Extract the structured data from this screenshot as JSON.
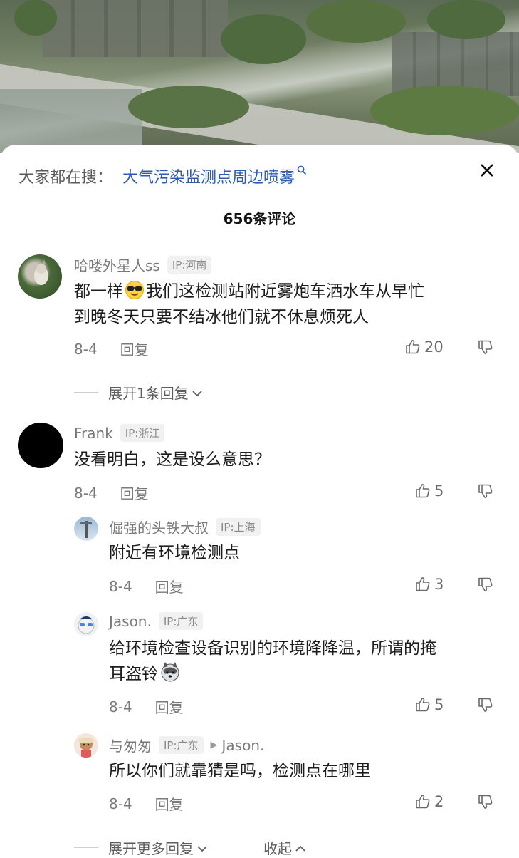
{
  "search": {
    "prefix": "大家都在搜：",
    "query": "大气污染监测点周边喷雾",
    "search_icon": "search-icon",
    "close_icon": "close-icon"
  },
  "comment_count": "656条评论",
  "comments": [
    {
      "user": "哈喽外星人ss",
      "ip": "IP:河南",
      "text_line1": "都一样",
      "emoji": "cool-sunglasses-emoji",
      "text_line1b": "我们这检测站附近雾炮车洒水车从早忙",
      "text_line2": "到晚冬天只要不结冰他们就不休息烦死人",
      "date": "8-4",
      "reply": "回复",
      "likes": "20"
    },
    {
      "user": "Frank",
      "ip": "IP:浙江",
      "text": "没看明白，这是设么意思？",
      "date": "8-4",
      "reply": "回复",
      "likes": "5"
    }
  ],
  "expand_first": "展开1条回复",
  "replies": [
    {
      "user": "倔强的头铁大叔",
      "ip": "IP:上海",
      "text": "附近有环境检测点",
      "date": "8-4",
      "reply": "回复",
      "likes": "3"
    },
    {
      "user": "Jason.",
      "ip": "IP:广东",
      "text_line1": "给环境检查设备识别的环境降降温，所谓的掩",
      "text_line2": "耳盗铃",
      "emoji": "husky-dog-emoji",
      "date": "8-4",
      "reply": "回复",
      "likes": "5"
    },
    {
      "user": "与匆匆",
      "ip": "IP:广东",
      "reply_to": "Jason.",
      "text": "所以你们就靠猜是吗，检测点在哪里",
      "date": "8-4",
      "reply": "回复",
      "likes": "2"
    }
  ],
  "expand_more": "展开更多回复",
  "collapse": "收起",
  "colors": {
    "link": "#2e5bb1",
    "meta": "#7a7a7a",
    "text": "#1d1d1f"
  }
}
